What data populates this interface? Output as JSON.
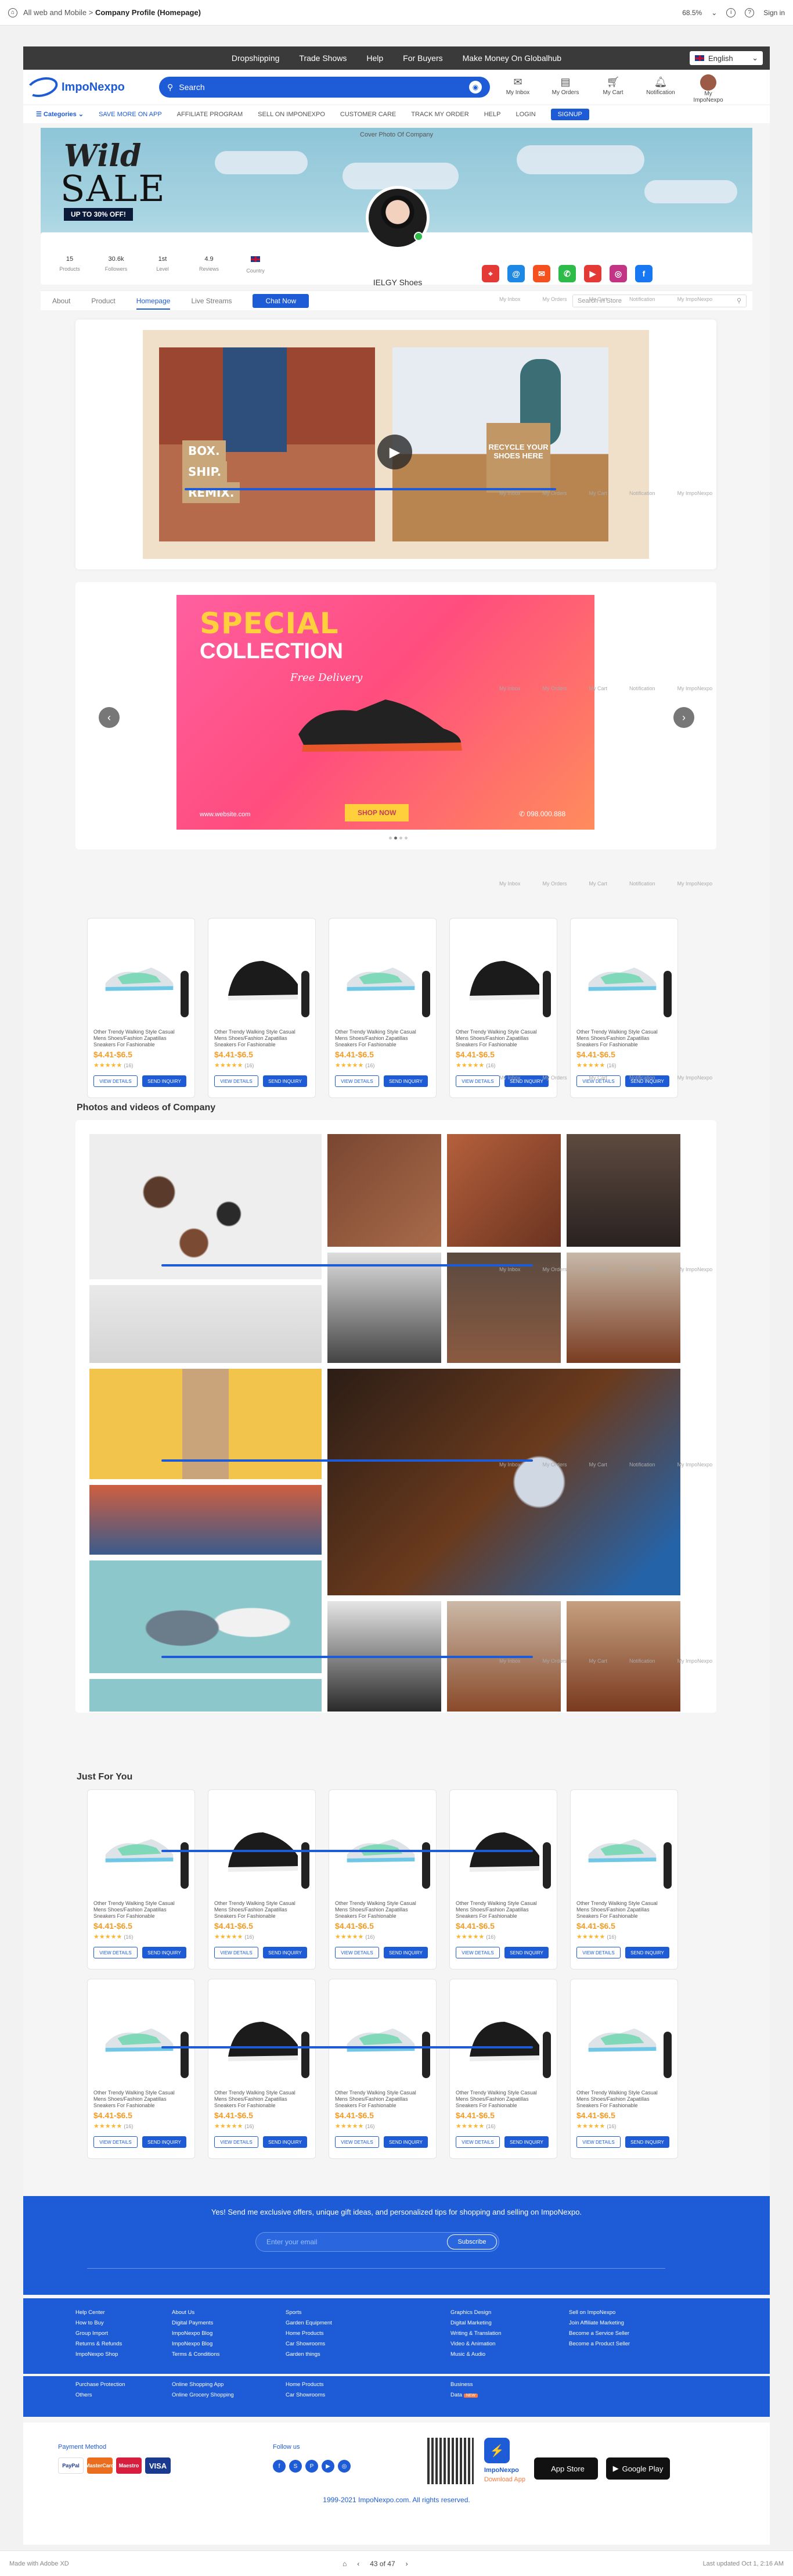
{
  "xd": {
    "breadcrumb_parent": "All web and Mobile",
    "breadcrumb_sep": ">",
    "breadcrumb_current": "Company Profile (Homepage)",
    "zoom": "68.5%",
    "sign_in": "Sign in",
    "made_with": "Made with Adobe XD",
    "page_indicator": "43 of 47",
    "last_updated": "Last updated Oct 1, 2:16 AM"
  },
  "topnav": {
    "items": [
      "Dropshipping",
      "Trade Shows",
      "Help",
      "For Buyers",
      "Make Money On Globalhub"
    ],
    "language": "English"
  },
  "header": {
    "logo_text": "ImpoNexpo",
    "search_placeholder": "Search",
    "icons": [
      {
        "label": "My Inbox",
        "icon": "mail-icon"
      },
      {
        "label": "My Orders",
        "icon": "orders-icon"
      },
      {
        "label": "My Cart",
        "icon": "cart-icon"
      },
      {
        "label": "Notification",
        "icon": "bell-icon"
      },
      {
        "label": "My ImpoNexpo",
        "icon": "avatar"
      }
    ]
  },
  "subnav": {
    "categories": "Categories",
    "items": [
      "SAVE MORE ON APP",
      "AFFILIATE PROGRAM",
      "SELL ON IMPONEXPO",
      "CUSTOMER CARE",
      "TRACK MY ORDER",
      "HELP",
      "LOGIN"
    ],
    "signup": "SIGNUP"
  },
  "cover": {
    "tag": "Cover Photo Of Company",
    "wild": "Wild",
    "sale": "SALE",
    "offer": "UP TO 30% OFF!"
  },
  "profile": {
    "name": "IELGY Shoes",
    "stats": [
      {
        "value": "15",
        "label": "Products"
      },
      {
        "value": "30.6k",
        "label": "Followers"
      },
      {
        "value": "1st",
        "label": "Level"
      },
      {
        "value": "4.9",
        "label": "Reviews"
      },
      {
        "value": "",
        "label": "Country"
      }
    ],
    "social": [
      {
        "icon": "location-icon",
        "color": "#e53935",
        "glyph": "⌖"
      },
      {
        "icon": "email-icon",
        "color": "#1e88e5",
        "glyph": "@"
      },
      {
        "icon": "mail-icon",
        "color": "#f4511e",
        "glyph": "✉"
      },
      {
        "icon": "whatsapp-icon",
        "color": "#2dbb4a",
        "glyph": "✆"
      },
      {
        "icon": "youtube-icon",
        "color": "#e53935",
        "glyph": "▶"
      },
      {
        "icon": "instagram-icon",
        "color": "#c13584",
        "glyph": "◎"
      },
      {
        "icon": "facebook-icon",
        "color": "#1877f2",
        "glyph": "f"
      }
    ]
  },
  "tabs": {
    "items": [
      "About",
      "Product",
      "Homepage",
      "Live Streams"
    ],
    "active": "Homepage",
    "chat": "Chat Now",
    "search_placeholder": "Search in Store"
  },
  "video": {
    "box_text": "BOX.",
    "ship_text": "SHIP.",
    "remix_text": "REMIX.",
    "recycle_text": "RECYCLE YOUR SHOES HERE"
  },
  "banner": {
    "special": "SPECIAL",
    "collection": "COLLECTION",
    "free_delivery": "Free Delivery",
    "website": "www.website.com",
    "shop_now": "SHOP NOW",
    "phone": "098.000.888"
  },
  "product": {
    "title": "Other Trendy Walking Style Casual Mens Shoes/Fashion Zapatillas Sneakers For Fashionable",
    "price": "$4.41-$6.5",
    "stars": "★★★★★",
    "reviews": "(16)",
    "btn_details": "VIEW DETAILS",
    "btn_inquiry": "SEND INQUIRY"
  },
  "sections": {
    "photos_title": "Photos and videos of Company",
    "jfy_title": "Just For You"
  },
  "newsletter": {
    "text": "Yes! Send me exclusive offers, unique gift ideas, and personalized tips for shopping and selling on ImpoNexpo.",
    "placeholder": "Enter your email",
    "subscribe": "Subscribe"
  },
  "footer": {
    "col1": [
      "Help Center",
      "How to Buy",
      "Group Import",
      "Returns & Refunds",
      "ImpoNexpo Shop"
    ],
    "col2": [
      "About Us",
      "Digital Payments",
      "ImpoNexpo Blog",
      "ImpoNexpo Blog",
      "Terms & Conditions"
    ],
    "col3": [
      "Sports",
      "Garden Equipment",
      "Home Products",
      "Car Showrooms",
      "Garden things"
    ],
    "col4": [
      "Graphics Design",
      "Digital Marketing",
      "Writing & Translation",
      "Video & Animation",
      "Music & Audio"
    ],
    "col5": [
      "Sell on ImpoNexpo",
      "Join Affiliate Marketing",
      "Become a Service Seller",
      "Become a Product Seller"
    ],
    "col1b": [
      "Purchase Protection",
      "Others"
    ],
    "col2b": [
      "Online Shopping App",
      "Online Grocery Shopping"
    ],
    "col3b": [
      "Home Products",
      "Car Showrooms"
    ],
    "col4b": [
      "Business",
      "Data"
    ],
    "new_badge": "NEW",
    "payment_title": "Payment Method",
    "follow_title": "Follow us",
    "app_brand": "ImpoNexpo",
    "download_app": "Download App",
    "app_store": "App Store",
    "google_play": "Google Play",
    "payments": [
      "PayPal",
      "MasterCard",
      "Maestro",
      "VISA"
    ],
    "copyright": "1999-2021 ImpoNexpo.com. All rights reserved."
  },
  "ghost_nav": [
    "My Inbox",
    "My Orders",
    "My Cart",
    "Notification",
    "My ImpoNexpo"
  ],
  "colors": {
    "brand": "#1e5bd6",
    "price": "#f39b27",
    "dark_bar": "#3a3a3a"
  }
}
